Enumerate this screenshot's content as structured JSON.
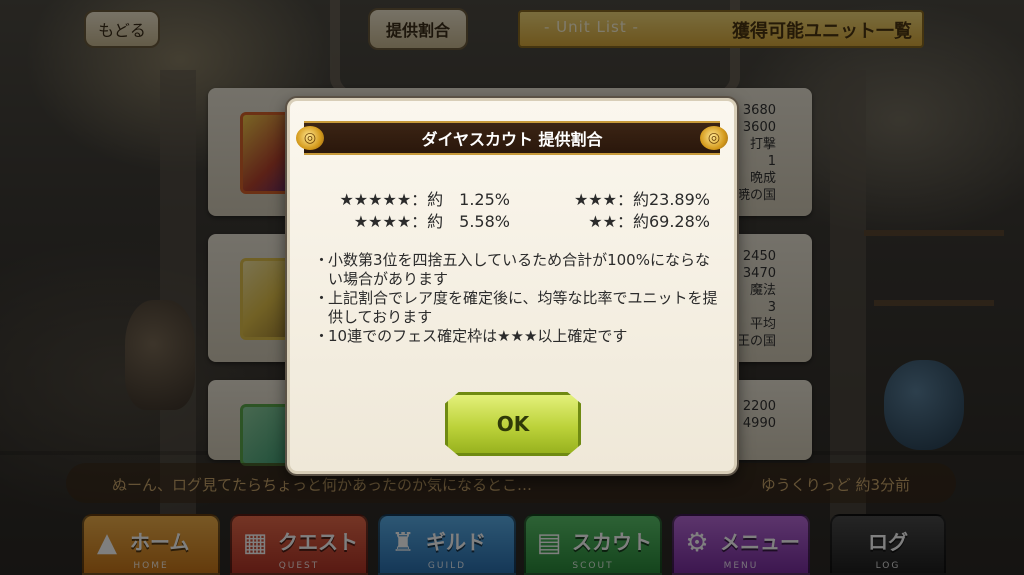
{
  "topbar": {
    "back_label": "もどる",
    "rates_label": "提供割合",
    "banner_en": "- Unit List -",
    "banner_ja": "獲得可能ユニット一覧"
  },
  "units": [
    {
      "stats": [
        "3680",
        "3600",
        "打撃",
        "1",
        "晩成",
        "暁の国"
      ]
    },
    {
      "stats": [
        "2450",
        "3470",
        "魔法",
        "3",
        "平均",
        "王の国"
      ]
    },
    {
      "stats": [
        "2200",
        "4990"
      ]
    }
  ],
  "modal": {
    "title": "ダイヤスカウト 提供割合",
    "rates": {
      "star5": "★★★★★：約　1.25%",
      "star4": "★★★★：約　5.58%",
      "star3": "★★★：約23.89%",
      "star2": "★★：約69.28%"
    },
    "notes": [
      "小数第3位を四捨五入しているため合計が100%にならない場合があります",
      "上記割合でレア度を確定後に、均等な比率でユニットを提供しております",
      "10連でのフェス確定枠は★★★以上確定です"
    ],
    "bullet": "・",
    "ok_label": "OK"
  },
  "chat": {
    "message": "ぬーん、ログ見てたらちょっと何かあったのか気になるとこ…",
    "author": "ゆうくりっど 約3分前"
  },
  "nav": [
    {
      "label": "ホーム",
      "en": "HOME",
      "color": "#e0922c"
    },
    {
      "label": "クエスト",
      "en": "QUEST",
      "color": "#d24a3a"
    },
    {
      "label": "ギルド",
      "en": "GUILD",
      "color": "#3a8fd0"
    },
    {
      "label": "スカウト",
      "en": "SCOUT",
      "color": "#3aa84a"
    },
    {
      "label": "メニュー",
      "en": "MENU",
      "color": "#9a4ab8"
    },
    {
      "label": "ログ",
      "en": "LOG",
      "color": "#333333"
    }
  ]
}
